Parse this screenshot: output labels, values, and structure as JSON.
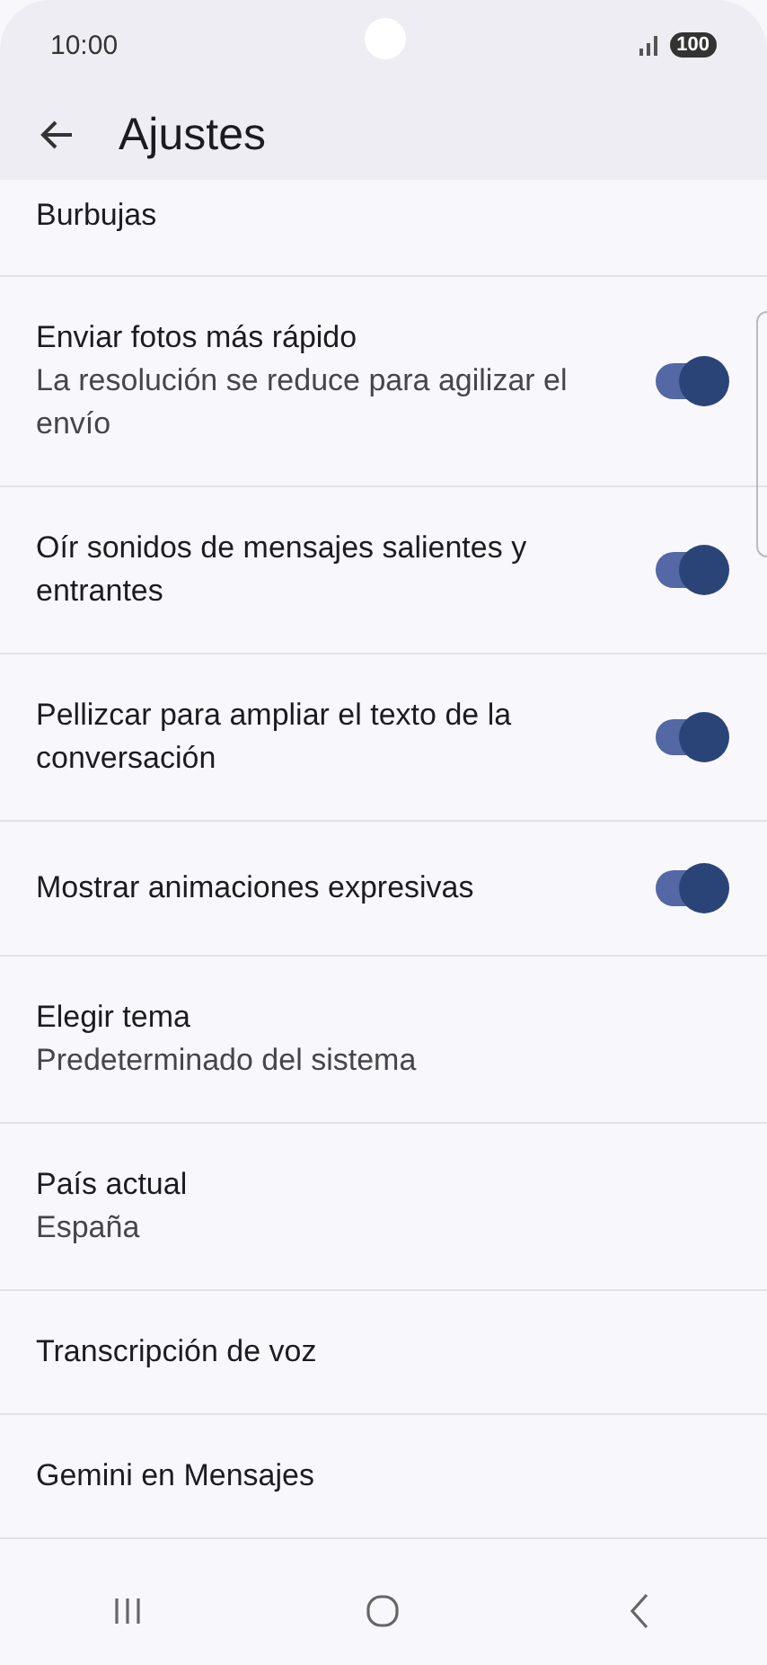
{
  "status_bar": {
    "time": "10:00",
    "battery": "100"
  },
  "header": {
    "title": "Ajustes"
  },
  "settings": [
    {
      "kind": "text",
      "title": "Burbujas"
    },
    {
      "kind": "toggle",
      "title": "Enviar fotos más rápido",
      "subtitle": "La resolución se reduce para agilizar el envío",
      "on": true
    },
    {
      "kind": "toggle",
      "title": "Oír sonidos de mensajes salientes y entrantes",
      "on": true
    },
    {
      "kind": "toggle",
      "title": "Pellizcar para ampliar el texto de la conversación",
      "on": true
    },
    {
      "kind": "toggle",
      "title": "Mostrar animaciones expresivas",
      "on": true
    },
    {
      "kind": "text",
      "title": "Elegir tema",
      "subtitle": "Predeterminado del sistema"
    },
    {
      "kind": "text",
      "title": "País actual",
      "subtitle": "España"
    },
    {
      "kind": "text",
      "title": "Transcripción de voz"
    },
    {
      "kind": "text",
      "title": "Gemini en Mensajes"
    }
  ]
}
